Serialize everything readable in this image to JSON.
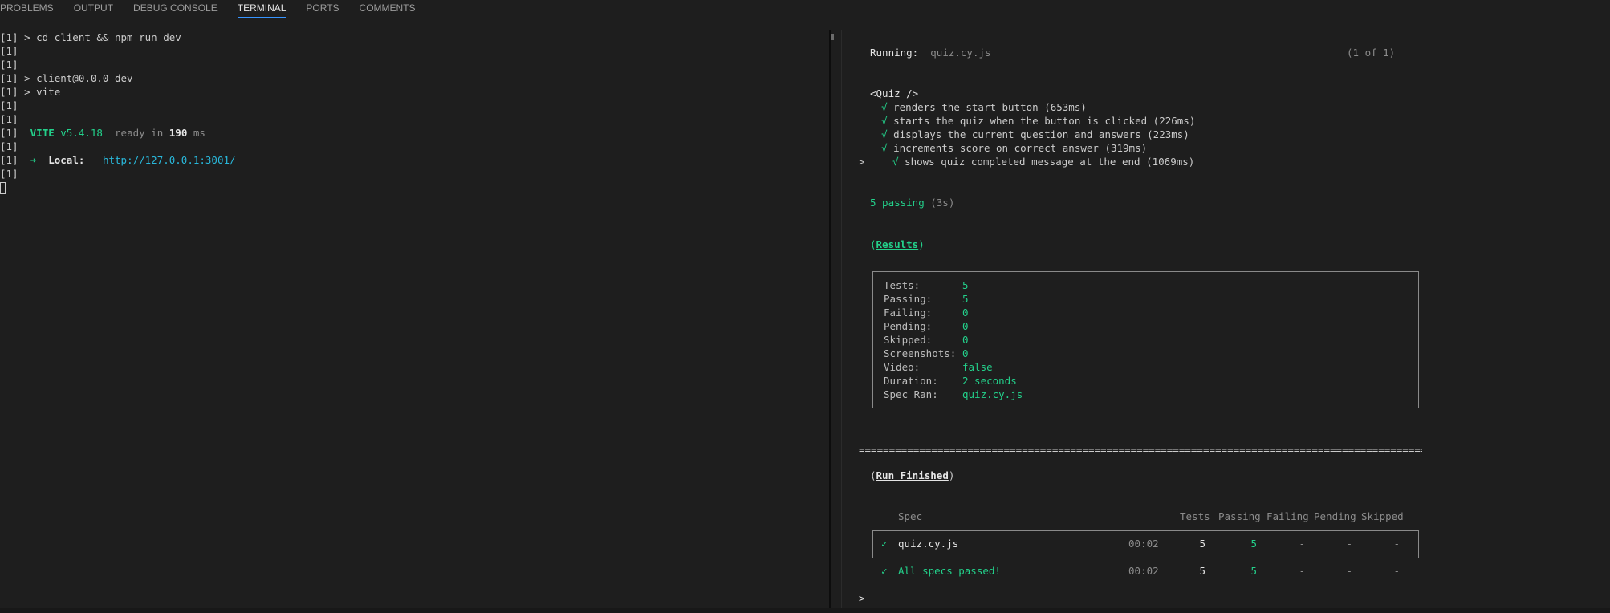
{
  "tabs": [
    "PROBLEMS",
    "OUTPUT",
    "DEBUG CONSOLE",
    "TERMINAL",
    "PORTS",
    "COMMENTS"
  ],
  "active_tab": "TERMINAL",
  "terminal_left": {
    "cmd": "[1] > cd client && npm run dev",
    "blank": "[1]",
    "pkg": "[1] > client@0.0.0 dev",
    "vite_cmd": "[1] > vite",
    "prefix": "[1]  ",
    "vite_name": "VITE",
    "vite_version": " v5.4.18",
    "ready_text": "  ready in ",
    "ready_ms": "190",
    "ms": " ms",
    "arrow": "➜",
    "local_label": "  Local:",
    "local_url": "http://127.0.0.1:3001/"
  },
  "cypress": {
    "running_label": "Running:",
    "running_file": "quiz.cy.js",
    "running_count": "(1 of 1)",
    "suite": "<Quiz />",
    "tests": [
      {
        "check": "√",
        "text": "renders the start button (653ms)"
      },
      {
        "check": "√",
        "text": "starts the quiz when the button is clicked (226ms)"
      },
      {
        "check": "√",
        "text": "displays the current question and answers (223ms)"
      },
      {
        "check": "√",
        "text": "increments score on correct answer (319ms)"
      },
      {
        "check": "√",
        "text": "shows quiz completed message at the end (1069ms)"
      }
    ],
    "prompt": ">",
    "passing": "5 passing",
    "passing_time": " (3s)",
    "results_open": "(",
    "results_label": "Results",
    "results_close": ")",
    "results": [
      {
        "key": "Tests:",
        "value": "5"
      },
      {
        "key": "Passing:",
        "value": "5"
      },
      {
        "key": "Failing:",
        "value": "0"
      },
      {
        "key": "Pending:",
        "value": "0"
      },
      {
        "key": "Skipped:",
        "value": "0"
      },
      {
        "key": "Screenshots:",
        "value": "0"
      },
      {
        "key": "Video:",
        "value": "false"
      },
      {
        "key": "Duration:",
        "value": "2 seconds"
      },
      {
        "key": "Spec Ran:",
        "value": "quiz.cy.js"
      }
    ],
    "divider": "==============================================================================================================================================",
    "run_finished_open": "(",
    "run_finished": "Run Finished",
    "run_finished_close": ")",
    "table_headers": {
      "spec": "Spec",
      "tests": "Tests",
      "passing": "Passing",
      "failing": "Failing",
      "pending": "Pending",
      "skipped": "Skipped"
    },
    "row": {
      "check": "✓",
      "spec": "quiz.cy.js",
      "time": "00:02",
      "tests": "5",
      "passing": "5",
      "failing": "-",
      "pending": "-",
      "skipped": "-"
    },
    "summary": {
      "check": "✓",
      "text": "All specs passed!",
      "time": "00:02",
      "tests": "5",
      "passing": "5",
      "failing": "-",
      "pending": "-",
      "skipped": "-"
    },
    "end_prompt": ">"
  },
  "colors": {
    "accent": "#3794ff",
    "success": "#23d18b",
    "link": "#29b8db",
    "background": "#1e1e1e"
  }
}
